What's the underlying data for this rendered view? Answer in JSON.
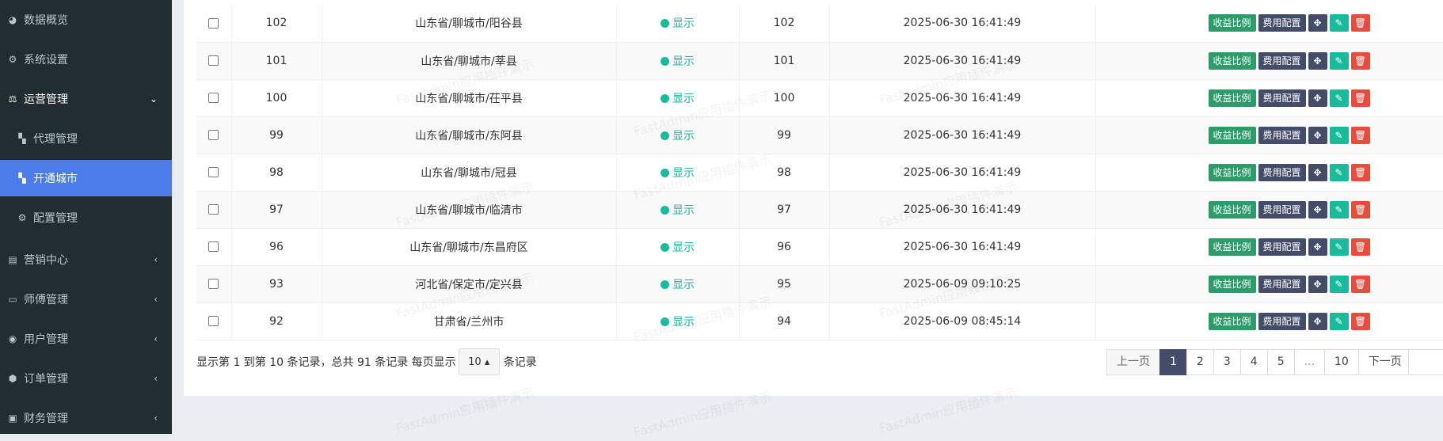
{
  "sidebar": {
    "items": [
      {
        "label": "数据概览",
        "icon": "dashboard-icon"
      },
      {
        "label": "系统设置",
        "icon": "gear-icon"
      },
      {
        "label": "运营管理",
        "icon": "balance-icon"
      },
      {
        "label": "代理管理",
        "icon": "grid-icon"
      },
      {
        "label": "开通城市",
        "icon": "grid-icon"
      },
      {
        "label": "配置管理",
        "icon": "gears-icon"
      },
      {
        "label": "营销中心",
        "icon": "calendar-icon"
      },
      {
        "label": "师傅管理",
        "icon": "id-card-icon"
      },
      {
        "label": "用户管理",
        "icon": "user-circle-icon"
      },
      {
        "label": "订单管理",
        "icon": "cube-icon"
      },
      {
        "label": "财务管理",
        "icon": "money-icon"
      }
    ]
  },
  "table": {
    "rows": [
      {
        "id": "102",
        "city": "山东省/聊城市/阳谷县",
        "status": "显示",
        "weigh": "102",
        "time": "2025-06-30 16:41:49"
      },
      {
        "id": "101",
        "city": "山东省/聊城市/莘县",
        "status": "显示",
        "weigh": "101",
        "time": "2025-06-30 16:41:49"
      },
      {
        "id": "100",
        "city": "山东省/聊城市/茌平县",
        "status": "显示",
        "weigh": "100",
        "time": "2025-06-30 16:41:49"
      },
      {
        "id": "99",
        "city": "山东省/聊城市/东阿县",
        "status": "显示",
        "weigh": "99",
        "time": "2025-06-30 16:41:49"
      },
      {
        "id": "98",
        "city": "山东省/聊城市/冠县",
        "status": "显示",
        "weigh": "98",
        "time": "2025-06-30 16:41:49"
      },
      {
        "id": "97",
        "city": "山东省/聊城市/临清市",
        "status": "显示",
        "weigh": "97",
        "time": "2025-06-30 16:41:49"
      },
      {
        "id": "96",
        "city": "山东省/聊城市/东昌府区",
        "status": "显示",
        "weigh": "96",
        "time": "2025-06-30 16:41:49"
      },
      {
        "id": "93",
        "city": "河北省/保定市/定兴县",
        "status": "显示",
        "weigh": "95",
        "time": "2025-06-09 09:10:25"
      },
      {
        "id": "92",
        "city": "甘肃省/兰州市",
        "status": "显示",
        "weigh": "94",
        "time": "2025-06-09 08:45:14"
      }
    ],
    "actions": {
      "ratio": "收益比例",
      "fee": "费用配置"
    }
  },
  "footer": {
    "info_prefix": "显示第 1 到第 10 条记录，总共 91 条记录 每页显示",
    "page_size": "10",
    "info_suffix": "条记录"
  },
  "pagination": {
    "prev": "上一页",
    "pages": [
      "1",
      "2",
      "3",
      "4",
      "5",
      "...",
      "10"
    ],
    "next": "下一页"
  },
  "watermark": "FastAdmin应用插件演示",
  "colors": {
    "sidebar_bg": "#222d32",
    "active": "#4c7cea",
    "success": "#18bc9c",
    "danger": "#e74c3c",
    "navy": "#444c69"
  }
}
